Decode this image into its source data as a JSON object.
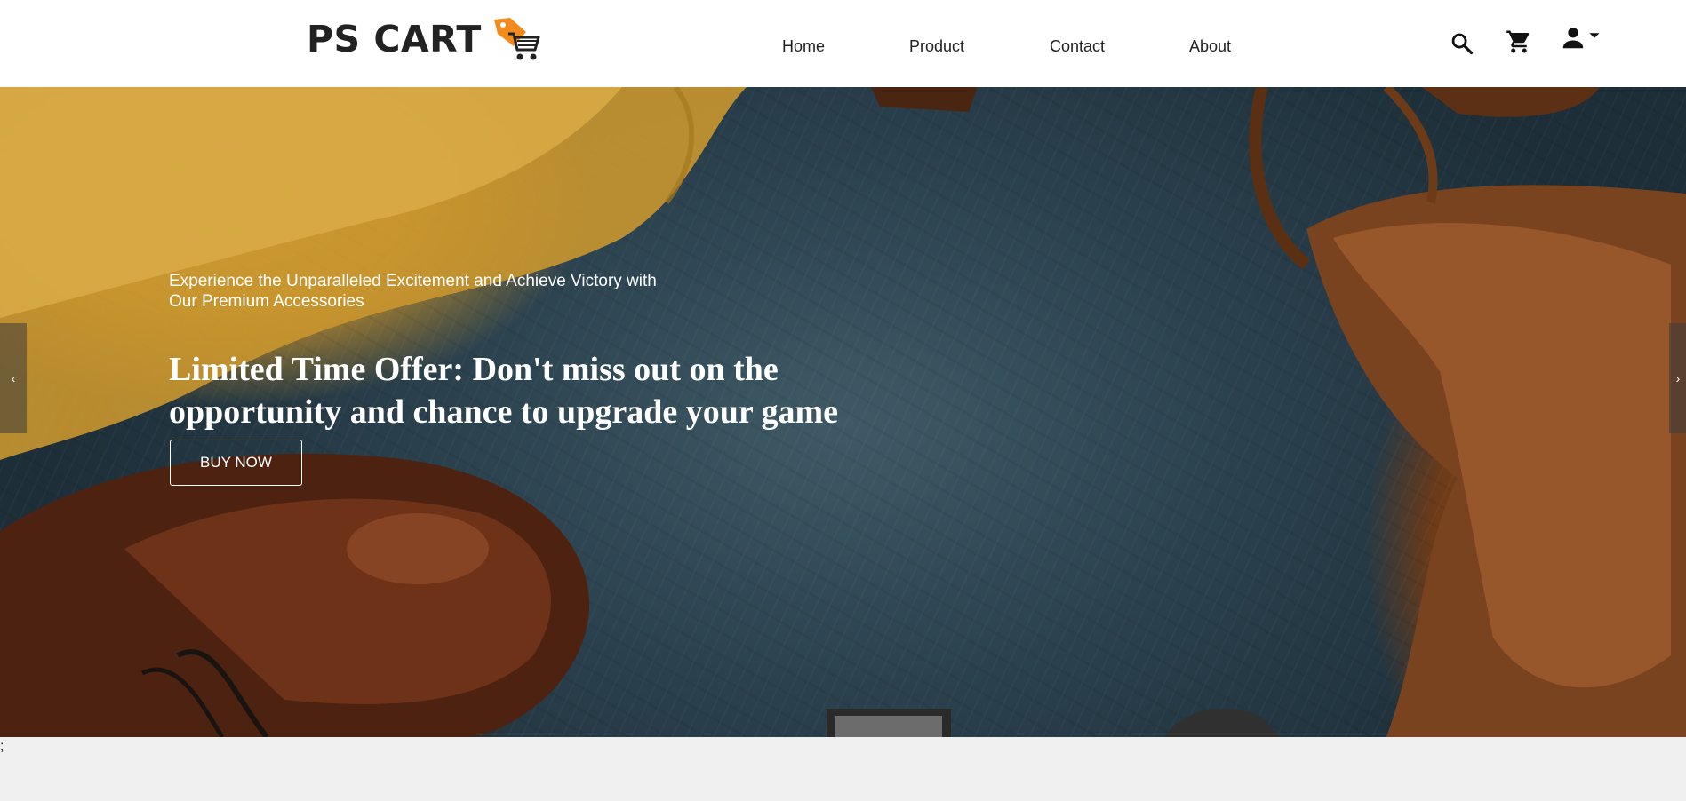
{
  "brand": {
    "name": "PS CART",
    "accent": "#f28a1e"
  },
  "nav": {
    "links": [
      {
        "label": "Home"
      },
      {
        "label": "Product"
      },
      {
        "label": "Contact"
      },
      {
        "label": "About"
      }
    ]
  },
  "icons": {
    "search": "search-icon",
    "cart": "shopping-cart-icon",
    "user": "user-icon",
    "dropdown": "caret-down-icon"
  },
  "hero": {
    "subtitle": "Experience the Unparalleled Excitement and Achieve Victory with Our Premium Accessories",
    "title": "Limited Time Offer: Don't miss out on the opportunity and chance to upgrade your game",
    "cta_label": "BUY NOW",
    "prev_label": "‹",
    "next_label": "›"
  },
  "footer": {
    "stray_text": ";"
  }
}
